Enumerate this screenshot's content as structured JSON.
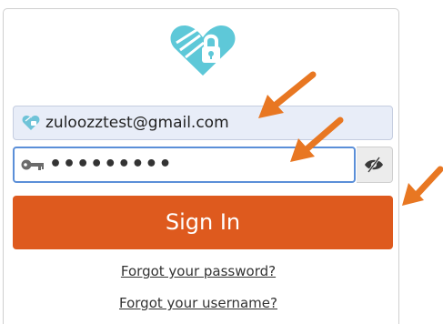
{
  "login": {
    "email_value": "zuloozztest@gmail.com",
    "password_value": "•••••••••",
    "signin_label": "Sign In",
    "forgot_password_label": "Forgot your password?",
    "forgot_username_label": "Forgot your username?"
  },
  "icons": {
    "logo": "heart-lock-logo",
    "email": "heart-icon",
    "password": "key-icon",
    "toggle": "eye-slash-icon",
    "annotation": "orange-arrow"
  },
  "colors": {
    "accent": "#de5a1e",
    "logo": "#5ec8d8",
    "email_bg": "#e8edf8",
    "focus_border": "#5b8fd8",
    "arrow": "#e87722"
  }
}
